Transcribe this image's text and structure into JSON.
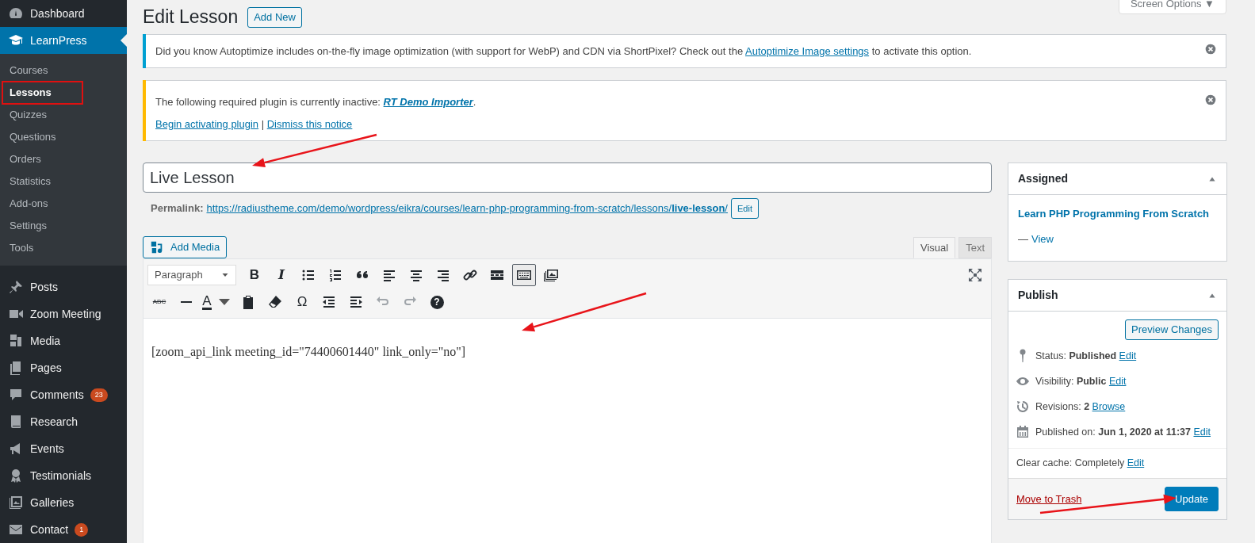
{
  "sidebar": {
    "items": [
      {
        "label": "Dashboard",
        "selected": false
      },
      {
        "label": "LearnPress",
        "selected": true,
        "children": [
          {
            "label": "Courses",
            "selected": false,
            "highlighted": false
          },
          {
            "label": "Lessons",
            "selected": true,
            "highlighted": true
          },
          {
            "label": "Quizzes",
            "selected": false,
            "highlighted": false
          },
          {
            "label": "Questions",
            "selected": false,
            "highlighted": false
          },
          {
            "label": "Orders",
            "selected": false,
            "highlighted": false
          },
          {
            "label": "Statistics",
            "selected": false,
            "highlighted": false
          },
          {
            "label": "Add-ons",
            "selected": false,
            "highlighted": false
          },
          {
            "label": "Settings",
            "selected": false,
            "highlighted": false
          },
          {
            "label": "Tools",
            "selected": false,
            "highlighted": false
          }
        ]
      },
      {
        "label": "Posts",
        "selected": false
      },
      {
        "label": "Zoom Meeting",
        "selected": false
      },
      {
        "label": "Media",
        "selected": false
      },
      {
        "label": "Pages",
        "selected": false
      },
      {
        "label": "Comments",
        "selected": false,
        "badge": "23"
      },
      {
        "label": "Research",
        "selected": false
      },
      {
        "label": "Events",
        "selected": false
      },
      {
        "label": "Testimonials",
        "selected": false
      },
      {
        "label": "Galleries",
        "selected": false
      },
      {
        "label": "Contact",
        "selected": false,
        "badge": "1"
      }
    ]
  },
  "screen_options": {
    "label": "Screen Options",
    "caret": "▼"
  },
  "page_title": "Edit Lesson",
  "add_new": "Add New",
  "notices": [
    {
      "color": "#00a0d2",
      "lines": [
        [
          {
            "text": "Did you know Autoptimize includes on-the-fly image optimization (with support for WebP) and CDN via ShortPixel? Check out the "
          },
          {
            "link": "Autoptimize Image settings"
          },
          {
            "text": " to activate this option."
          }
        ]
      ]
    },
    {
      "color": "#ffb900",
      "lines": [
        [
          {
            "text": "The following required plugin is currently inactive: "
          },
          {
            "link": "RT Demo Importer",
            "emphasis": true
          },
          {
            "text": "."
          }
        ],
        [
          {
            "link": "Begin activating plugin"
          },
          {
            "text": " | "
          },
          {
            "link": "Dismiss this notice"
          }
        ]
      ]
    }
  ],
  "title_field": {
    "value": "Live Lesson"
  },
  "permalink": {
    "label": "Permalink:",
    "url": "https://radiustheme.com/demo/wordpress/eikra/courses/learn-php-programming-from-scratch/lessons/**live-lesson**/",
    "button": "Edit"
  },
  "add_media": "Add Media",
  "editor_tabs": [
    {
      "label": "Visual",
      "selected": true
    },
    {
      "label": "Text",
      "selected": false
    }
  ],
  "format_select": {
    "value": "Paragraph"
  },
  "toolbar_rows": [
    [
      {
        "kind": "bold",
        "glyph": "B"
      },
      {
        "kind": "italic",
        "glyph": "I"
      },
      {
        "kind": "bullet-list"
      },
      {
        "kind": "numbered-list"
      },
      {
        "kind": "blockquote"
      },
      {
        "kind": "align-left"
      },
      {
        "kind": "align-center"
      },
      {
        "kind": "align-right"
      },
      {
        "kind": "link"
      },
      {
        "kind": "read-more"
      },
      {
        "kind": "toolbar-toggle",
        "pressed": true
      },
      {
        "kind": "pictures"
      }
    ],
    [
      {
        "kind": "strikethrough",
        "glyph": "ABC"
      },
      {
        "kind": "horizontal-line"
      },
      {
        "kind": "text-color",
        "glyph": "A"
      },
      {
        "kind": "paste-text"
      },
      {
        "kind": "eraser"
      },
      {
        "kind": "special-character",
        "glyph": "Ω"
      },
      {
        "kind": "outdent"
      },
      {
        "kind": "indent"
      },
      {
        "kind": "undo",
        "disabled": true
      },
      {
        "kind": "redo",
        "disabled": true
      },
      {
        "kind": "help",
        "glyph": "?"
      }
    ]
  ],
  "content": "[zoom_api_link meeting_id=\"74400601440\" link_only=\"no\"]",
  "assigned": {
    "title": "Assigned",
    "course": "Learn PHP Programming From Scratch",
    "dash": "—",
    "view": "View"
  },
  "publish": {
    "title": "Publish",
    "preview": "Preview Changes",
    "rows": [
      {
        "kind": "status",
        "text": "Status: **Published**",
        "link": "Edit"
      },
      {
        "kind": "visibility",
        "text": "Visibility: **Public**",
        "link": "Edit"
      },
      {
        "kind": "revisions",
        "text": "Revisions: **2**",
        "link": "Browse"
      },
      {
        "kind": "published",
        "text": "Published on: **Jun 1, 2020 at 11:37**",
        "link": "Edit"
      },
      {
        "kind": "cache",
        "text": "Clear cache: Completely",
        "link": "Edit"
      }
    ],
    "trash": "Move to Trash",
    "update": "Update"
  }
}
